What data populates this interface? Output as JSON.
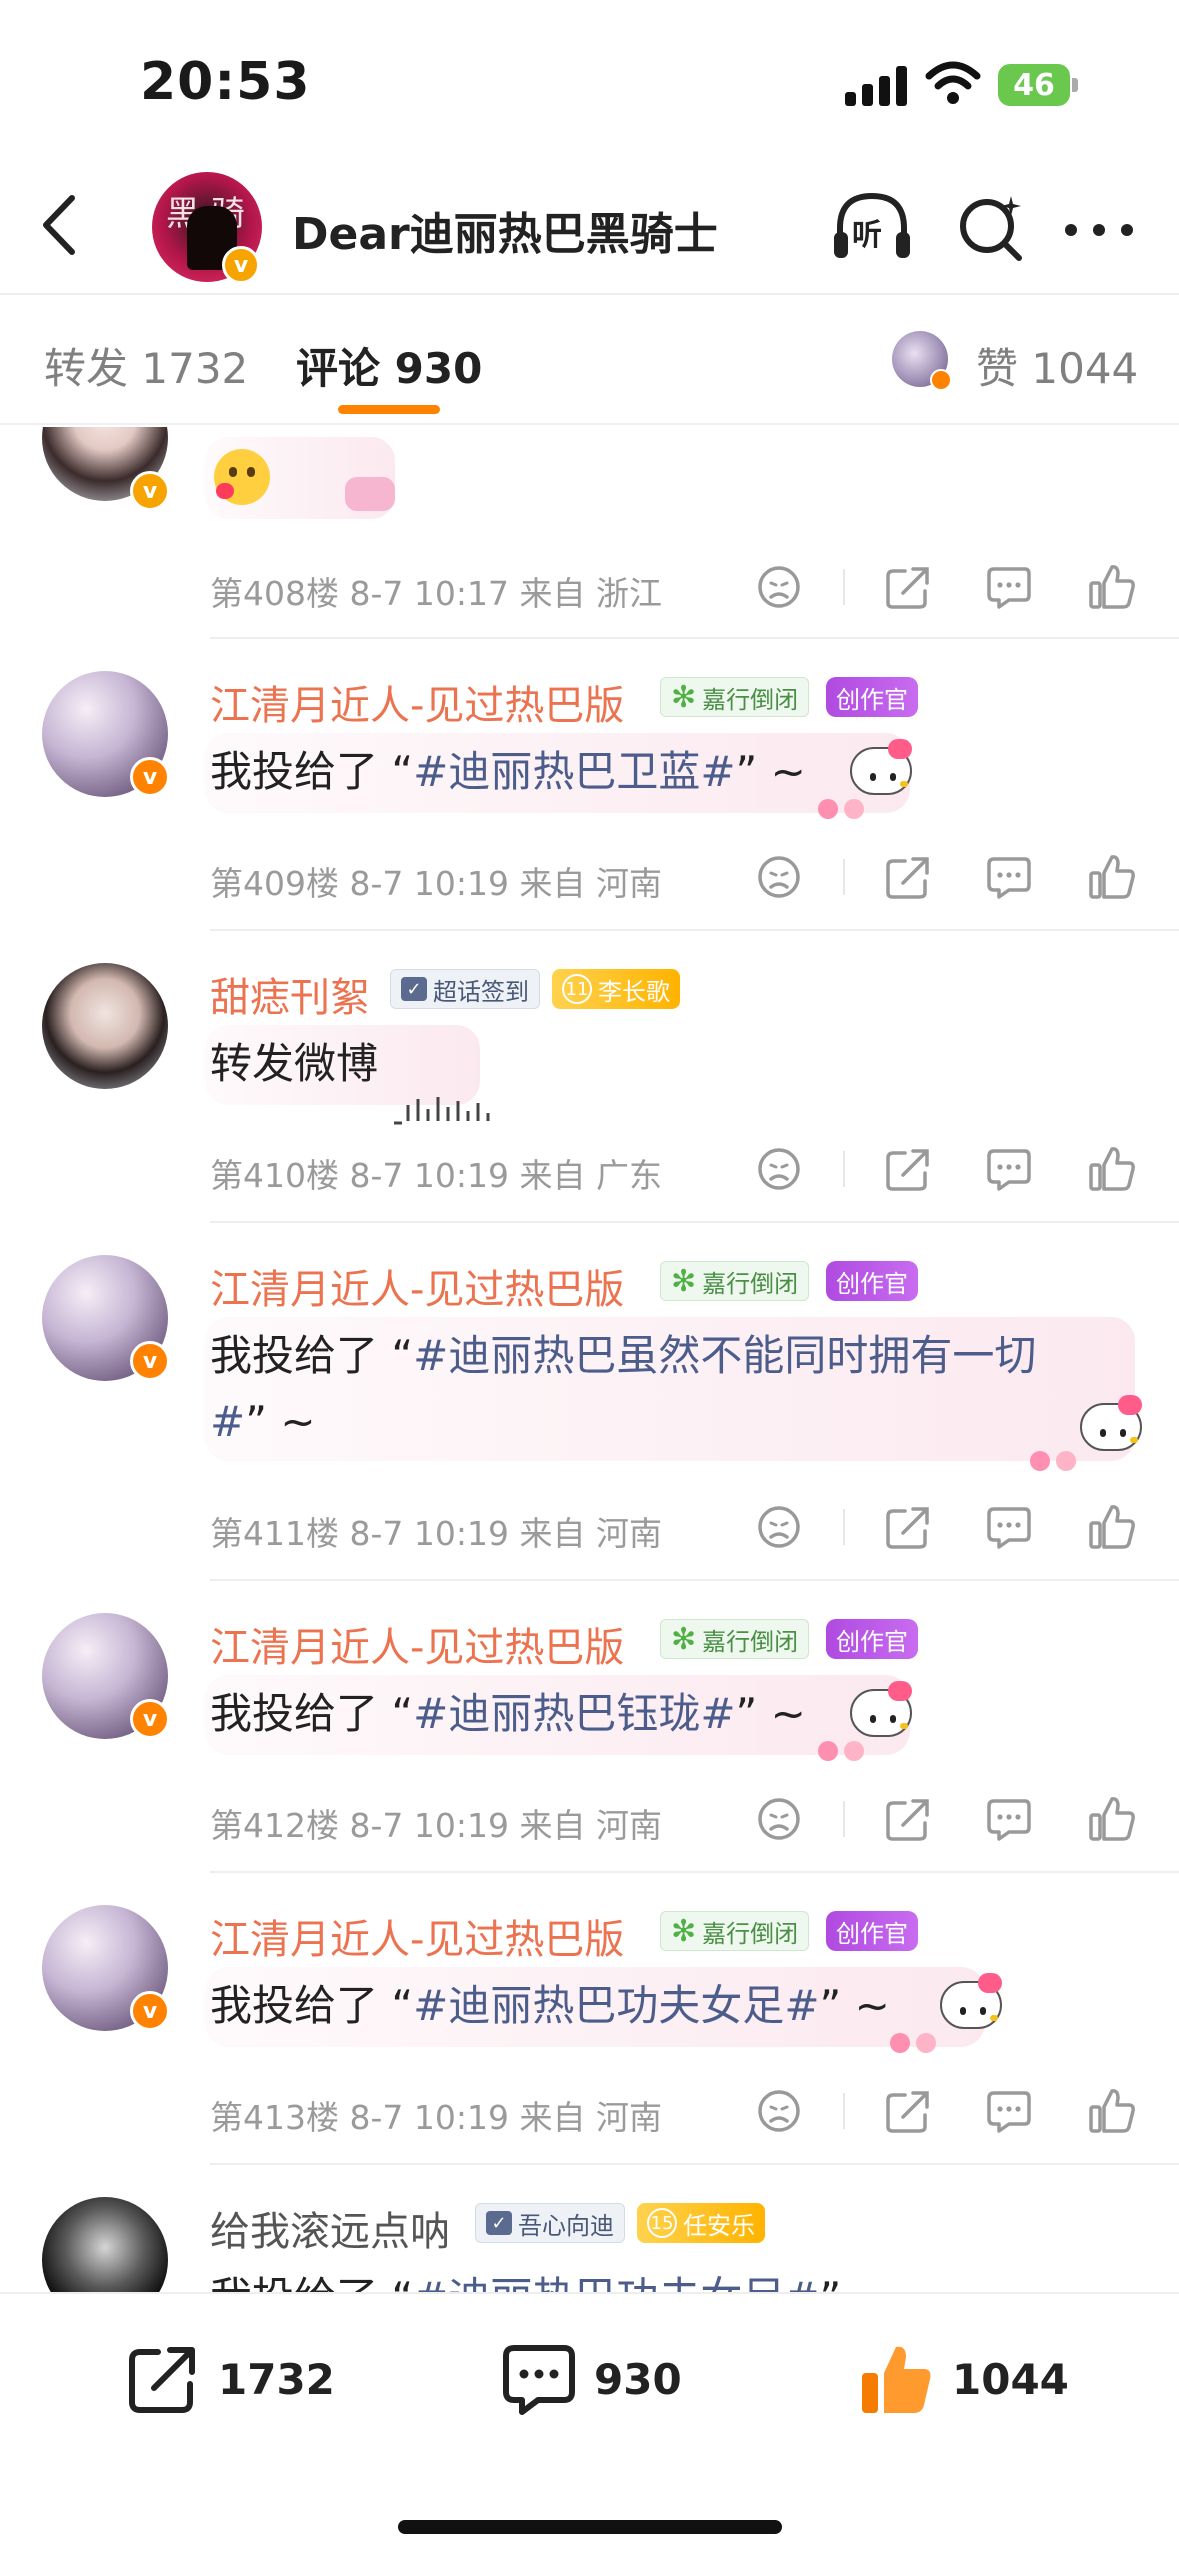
{
  "status_bar": {
    "time": "20:53",
    "battery": "46"
  },
  "nav": {
    "title": "Dear迪丽热巴黑骑士",
    "listen_label": "听",
    "avatar_glyph": "黑 骑"
  },
  "tabs": {
    "repost_label": "转发",
    "repost_count": "1732",
    "comments_label": "评论",
    "comments_count": "930",
    "likes_label": "赞",
    "likes_count": "1044"
  },
  "comments": [
    {
      "meta": "第408楼 8-7 10:17 来自 浙江"
    },
    {
      "name": "江清月近人-见过热巴版",
      "badge1": "嘉行倒闭",
      "badge2": "创作官",
      "text_prefix": "我投给了 “",
      "text_tag": "#迪丽热巴卫蓝#",
      "text_suffix": "” ~",
      "meta": "第409楼 8-7 10:19 来自 河南"
    },
    {
      "name": "甜痣刊絮",
      "badge1": "超话签到",
      "badge2_level": "11",
      "badge2": "李长歌",
      "text": "转发微博",
      "meta": "第410楼 8-7 10:19 来自 广东"
    },
    {
      "name": "江清月近人-见过热巴版",
      "badge1": "嘉行倒闭",
      "badge2": "创作官",
      "text_prefix": "我投给了 “",
      "text_tag_line1": "#迪丽热巴虽然不能同时拥有一切",
      "text_tag_line2": "#",
      "text_suffix": "” ~",
      "meta": "第411楼 8-7 10:19 来自 河南"
    },
    {
      "name": "江清月近人-见过热巴版",
      "badge1": "嘉行倒闭",
      "badge2": "创作官",
      "text_prefix": "我投给了 “",
      "text_tag": "#迪丽热巴钰珑#",
      "text_suffix": "” ~",
      "meta": "第412楼 8-7 10:19 来自 河南"
    },
    {
      "name": "江清月近人-见过热巴版",
      "badge1": "嘉行倒闭",
      "badge2": "创作官",
      "text_prefix": "我投给了 “",
      "text_tag": "#迪丽热巴功夫女足#",
      "text_suffix": "” ~",
      "meta": "第413楼 8-7 10:19 来自 河南"
    },
    {
      "name": "给我滚远点呐",
      "badge1": "吾心向迪",
      "badge2_level": "15",
      "badge2": "任安乐",
      "text_prefix": "我投给了 “",
      "text_tag": "#迪丽热巴功夫女足#",
      "text_suffix": "”"
    }
  ],
  "bottom_bar": {
    "repost_count": "1732",
    "comment_count": "930",
    "like_count": "1044"
  },
  "colors": {
    "accent": "#ff8200",
    "username": "#eb7350",
    "topic": "#4c5d8c",
    "like_orange": "#ff8200"
  }
}
